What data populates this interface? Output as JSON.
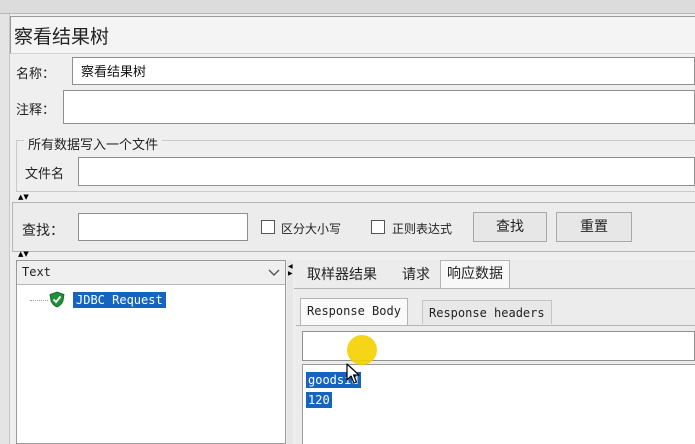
{
  "window": {
    "title": "察看结果树"
  },
  "form": {
    "name_label": "名称：",
    "name_value": "察看结果树",
    "comment_label": "注释：",
    "comment_value": "",
    "file_group_label": "所有数据写入一个文件",
    "filename_label": "文件名",
    "filename_value": ""
  },
  "search": {
    "label": "查找：",
    "value": "",
    "case_sensitive_label": "区分大小写",
    "case_sensitive_checked": false,
    "regex_label": "正则表达式",
    "regex_checked": false,
    "find_button": "查找",
    "reset_button": "重置"
  },
  "results_tree": {
    "renderer": "Text",
    "nodes": [
      {
        "label": "JDBC Request",
        "status": "success",
        "icon": "shield-check-icon",
        "selected": true
      }
    ]
  },
  "result_tabs": {
    "tabs": [
      "取样器结果",
      "请求",
      "响应数据"
    ],
    "active_tab": "响应数据",
    "response_subtabs": [
      "Response Body",
      "Response headers"
    ],
    "active_subtab": "Response Body"
  },
  "response": {
    "lines": [
      "goodsid",
      "120"
    ]
  },
  "colors": {
    "selection": "#1565c0",
    "success_shield": "#1e8f3a",
    "cursor_highlight": "#f5d000"
  }
}
